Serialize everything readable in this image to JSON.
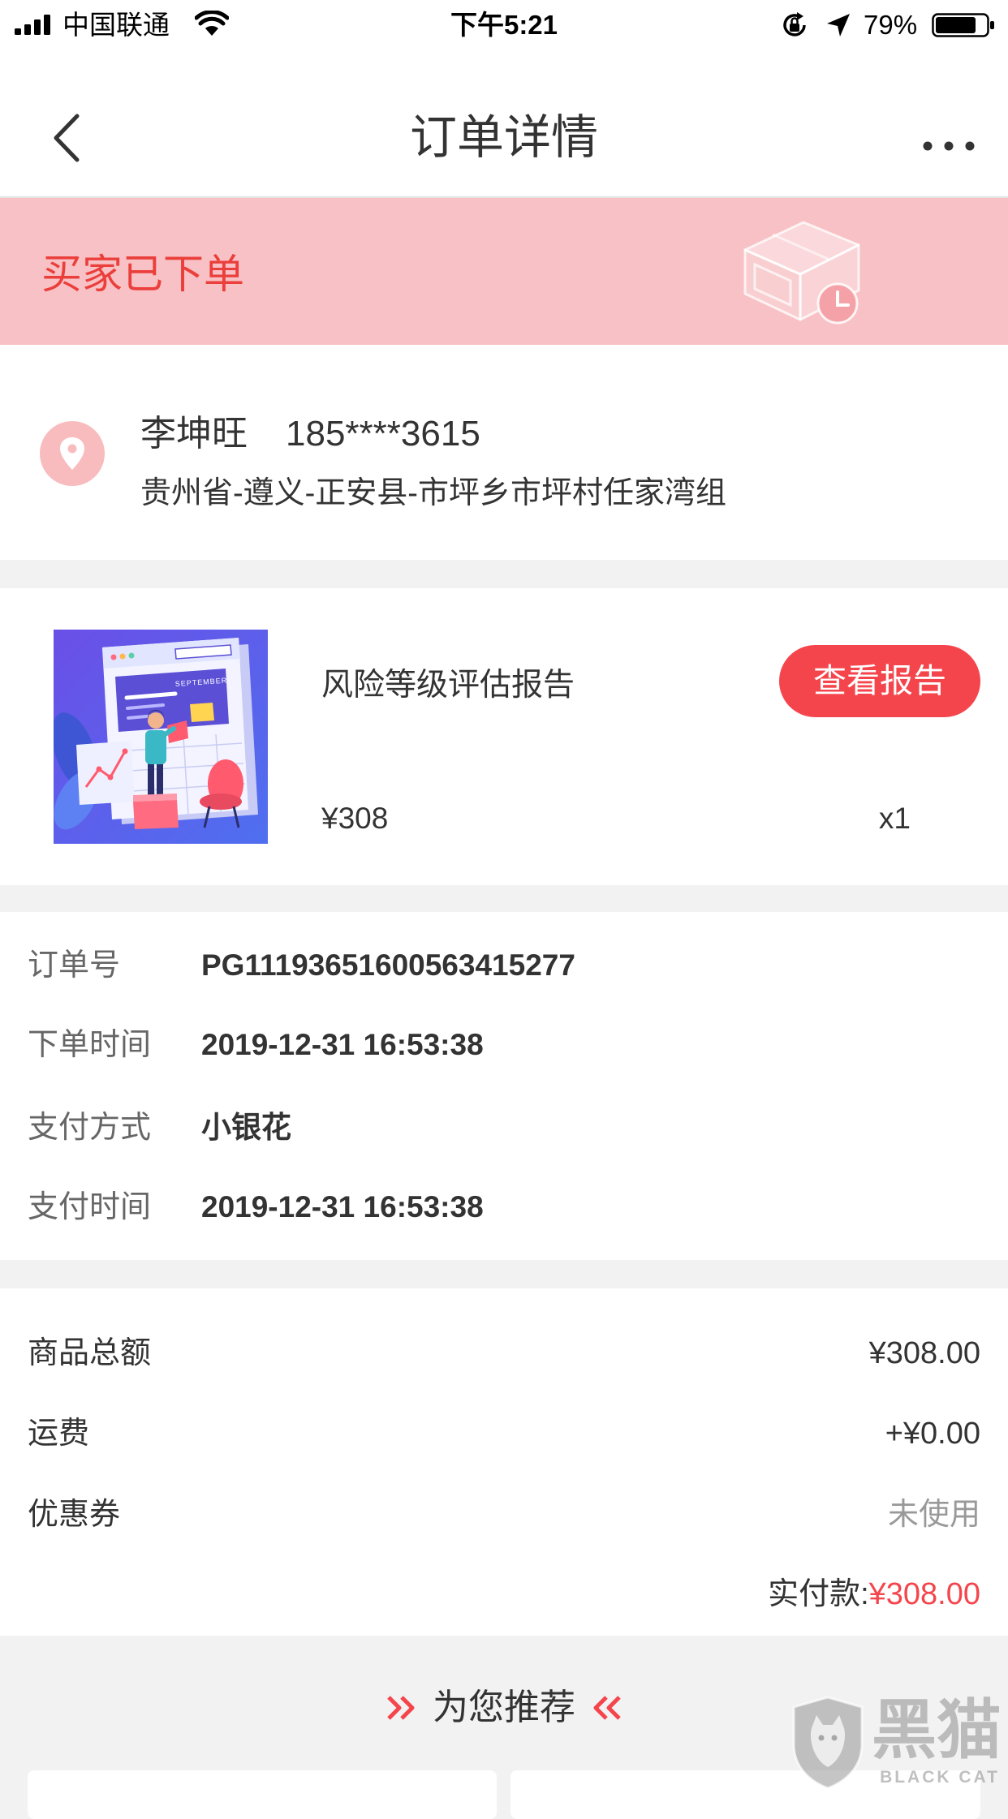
{
  "status_bar": {
    "carrier": "中国联通",
    "time": "下午5:21",
    "battery_text": "79%",
    "battery_level": 0.79,
    "signal_bars": 4,
    "icons": [
      "signal-strength-icon",
      "wifi-icon",
      "orientation-lock-icon",
      "location-arrow-icon",
      "battery-icon"
    ]
  },
  "nav": {
    "title": "订单详情",
    "back_icon": "chevron-left-icon",
    "more_icon": "more-dots-icon"
  },
  "banner": {
    "status_text": "买家已下单",
    "icon": "package-clock-icon"
  },
  "address": {
    "icon": "location-pin-icon",
    "name": "李坤旺",
    "phone": "185****3615",
    "detail": "贵州省-遵义-正安县-市坪乡市坪村任家湾组"
  },
  "product": {
    "thumbnail_text": "SEPTEMBER",
    "title": "风险等级评估报告",
    "action_label": "查看报告",
    "price": "¥308",
    "quantity": "x1"
  },
  "order_info": {
    "rows": [
      {
        "label": "订单号",
        "value": "PG11193651600563415277"
      },
      {
        "label": "下单时间",
        "value": "2019-12-31 16:53:38"
      },
      {
        "label": "支付方式",
        "value": "小银花"
      },
      {
        "label": "支付时间",
        "value": "2019-12-31 16:53:38"
      }
    ]
  },
  "amounts": {
    "rows": [
      {
        "label": "商品总额",
        "value": "¥308.00"
      },
      {
        "label": "运费",
        "value": "+¥0.00"
      },
      {
        "label": "优惠券",
        "value": "未使用"
      }
    ],
    "total_label": "实付款:",
    "total_value": "¥308.00"
  },
  "recommend": {
    "title": "为您推荐",
    "left_icon": "double-chevron-right-icon",
    "right_icon": "double-chevron-left-icon"
  },
  "watermark": {
    "logo_text": "黑猫",
    "logo_subtext": "BLACK CAT"
  },
  "colors": {
    "accent": "#f5454c",
    "banner_bg": "#f8c1c5",
    "banner_text": "#ea3f3b",
    "page_bg": "#f2f2f3"
  }
}
